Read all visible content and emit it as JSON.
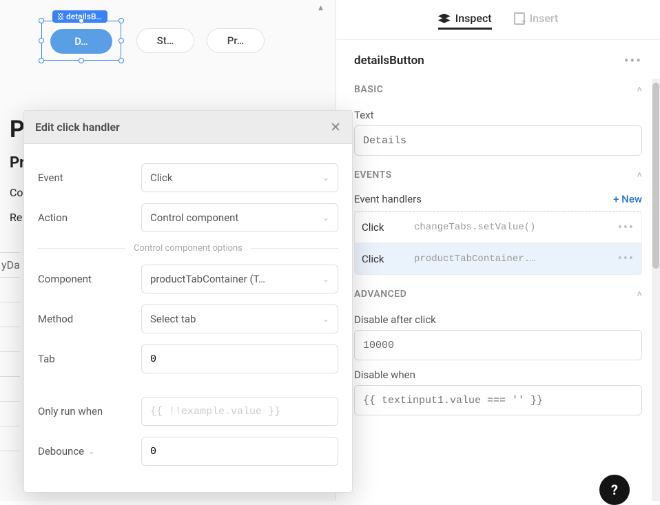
{
  "canvas": {
    "selected_component_tag": "detailsB…",
    "pill_primary": "D…",
    "pill_2": "St…",
    "pill_3": "Pr…",
    "underlay_big": "P",
    "underlay_mid": "Pr",
    "underlay_row1": "Co",
    "underlay_row2": "Re",
    "table_frag": "yDa"
  },
  "modal": {
    "title": "Edit click handler",
    "event_label": "Event",
    "event_value": "Click",
    "action_label": "Action",
    "action_value": "Control component",
    "options_divider": "Control component options",
    "component_label": "Component",
    "component_value": "productTabContainer (T…",
    "method_label": "Method",
    "method_value": "Select tab",
    "tab_label": "Tab",
    "tab_value": "0",
    "only_run_label": "Only run when",
    "only_run_placeholder": "{{ !!example.value }}",
    "debounce_label": "Debounce",
    "debounce_value": "0"
  },
  "inspector": {
    "tabs": {
      "inspect": "Inspect",
      "insert": "Insert"
    },
    "component_name": "detailsButton",
    "basic": {
      "heading": "BASIC",
      "text_label": "Text",
      "text_value": "Details"
    },
    "events": {
      "heading": "EVENTS",
      "handlers_label": "Event handlers",
      "new_label": "+ New",
      "rows": [
        {
          "event": "Click",
          "code": "changeTabs.setValue()"
        },
        {
          "event": "Click",
          "code": "productTabContainer.…"
        }
      ]
    },
    "advanced": {
      "heading": "ADVANCED",
      "disable_after_label": "Disable after click",
      "disable_after_value": "10000",
      "disable_when_label": "Disable when",
      "disable_when_placeholder": "{{ textinput1.value === '' }}"
    }
  },
  "help_fab": "?"
}
